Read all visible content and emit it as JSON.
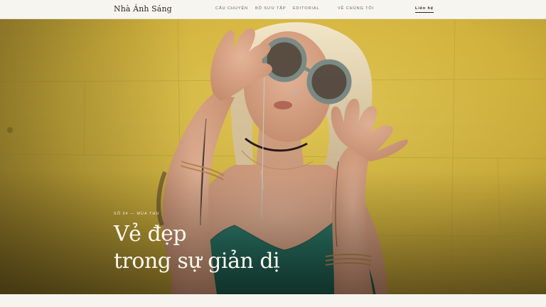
{
  "brand": {
    "name": "Nhà Ánh Sáng"
  },
  "nav": {
    "items": [
      "Câu chuyện",
      "Bộ sưu tập",
      "Editorial",
      "Về chúng tôi"
    ],
    "contact_label": "Liên hệ"
  },
  "hero": {
    "kicker": "Số 04 — Mùa thu",
    "headline_line1": "Vẻ đẹp",
    "headline_line2": "trong sự giản dị",
    "image_description_icon": "portrait-photo"
  },
  "colors": {
    "background": "#f6f4ef",
    "nav_text": "#6d675f",
    "brand_text": "#2a2622",
    "hero_wall": "#d6b944",
    "headline": "#fffaf0"
  }
}
